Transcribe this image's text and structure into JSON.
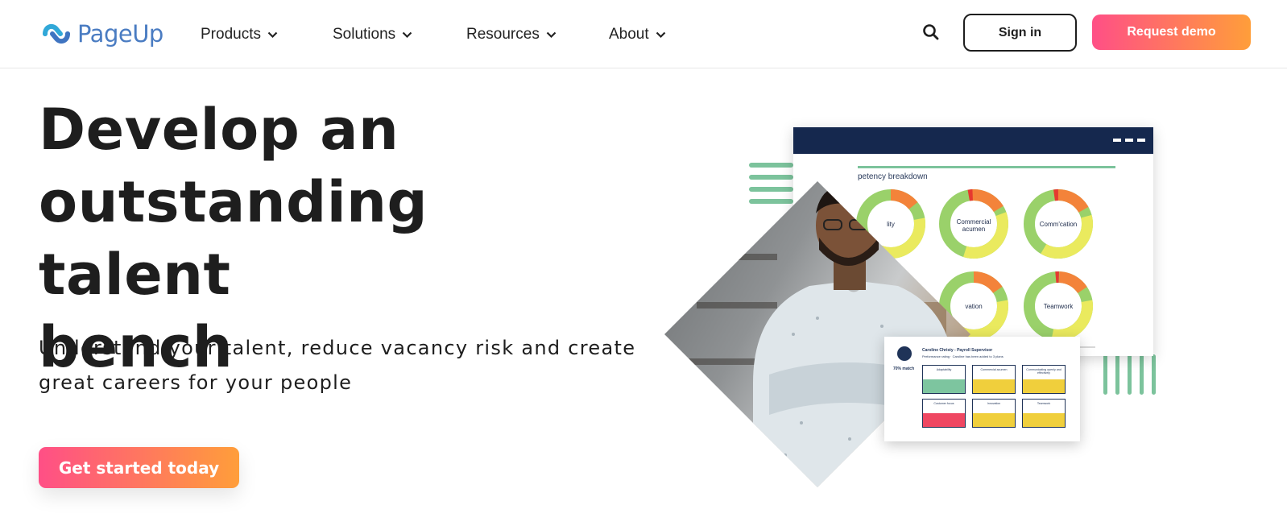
{
  "header": {
    "logo_text": "PageUp",
    "nav": [
      {
        "label": "Products"
      },
      {
        "label": "Solutions"
      },
      {
        "label": "Resources"
      },
      {
        "label": "About"
      }
    ],
    "sign_in_label": "Sign in",
    "request_demo_label": "Request demo"
  },
  "hero": {
    "headline_lines": [
      "Develop an",
      "outstanding talent",
      "bench"
    ],
    "subhead_lines": [
      "Understand your talent, reduce vacancy risk and create",
      "great careers for your people"
    ],
    "cta_label": "Get started today"
  },
  "illustration": {
    "dashboard_title": "petency breakdown",
    "donuts": [
      {
        "label": "lity"
      },
      {
        "label": "Commercial acumen"
      },
      {
        "label": "Comm'cation"
      },
      {
        "label": "vation"
      },
      {
        "label": "Teamwork"
      }
    ],
    "profile": {
      "name": "Caroline Christy - Payroll Supervisor",
      "subtitle": "Performance rating · Caroline has been added to 3 plans",
      "match": "70% match",
      "tiles": [
        {
          "label": "Adaptability",
          "color": "#7dc59f"
        },
        {
          "label": "Commercial acumen",
          "color": "#f0cf3c"
        },
        {
          "label": "Communicating openly and effectively",
          "color": "#f0cf3c"
        },
        {
          "label": "Customer focus",
          "color": "#ef4762"
        },
        {
          "label": "Innovation",
          "color": "#f0cf3c"
        },
        {
          "label": "Teamwork",
          "color": "#f0cf3c"
        }
      ]
    }
  },
  "colors": {
    "brand_blue": "#4a7cc2",
    "gradient_start": "#ff4f86",
    "gradient_end": "#ff9e3a",
    "navy": "#15284e",
    "accent_green": "#7cc39c"
  }
}
